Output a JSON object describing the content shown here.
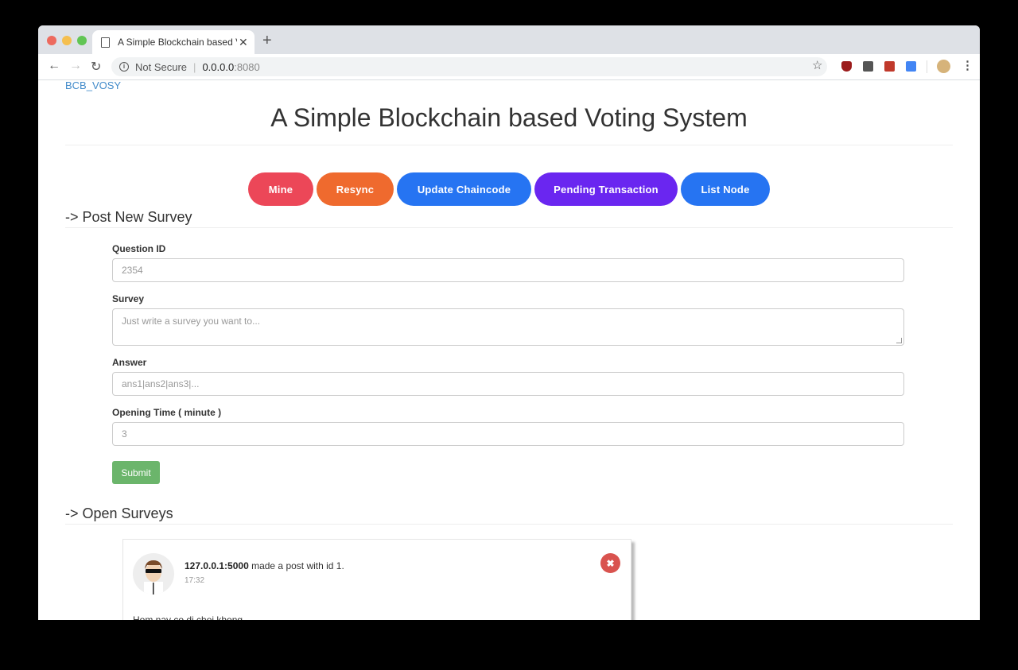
{
  "browser": {
    "tab_title": "A Simple Blockchain based Voting System",
    "tab_title_visible": "A Simple Blockchain based Vot",
    "security_label": "Not Secure",
    "url_host": "0.0.0.0",
    "url_port": ":8080",
    "extensions": [
      "ublock-icon",
      "extension-icon",
      "book-icon",
      "translate-icon"
    ]
  },
  "header": {
    "brand": "BCB_VOSY",
    "title": "A Simple Blockchain based Voting System"
  },
  "actions": [
    {
      "label": "Mine",
      "color": "#ec4758"
    },
    {
      "label": "Resync",
      "color": "#ef6a2e"
    },
    {
      "label": "Update Chaincode",
      "color": "#2674f2"
    },
    {
      "label": "Pending Transaction",
      "color": "#6a26f0"
    },
    {
      "label": "List Node",
      "color": "#2674f2"
    }
  ],
  "post_survey": {
    "heading": "-> Post New Survey",
    "question_id": {
      "label": "Question ID",
      "placeholder": "2354"
    },
    "survey": {
      "label": "Survey",
      "placeholder": "Just write a survey you want to..."
    },
    "answer": {
      "label": "Answer",
      "placeholder": "ans1|ans2|ans3|..."
    },
    "opening_time": {
      "label": "Opening Time ( minute )",
      "placeholder": "3"
    },
    "submit_label": "Submit"
  },
  "open_surveys": {
    "heading": "-> Open Surveys",
    "posts": [
      {
        "author": "127.0.0.1:5000",
        "action_text": " made a post with id 1.",
        "time": "17:32",
        "body": "Hom nay co di choi khong"
      }
    ]
  },
  "colors": {
    "submit": "#6bb56b",
    "close": "#d9534f",
    "brand_link": "#428bca"
  }
}
